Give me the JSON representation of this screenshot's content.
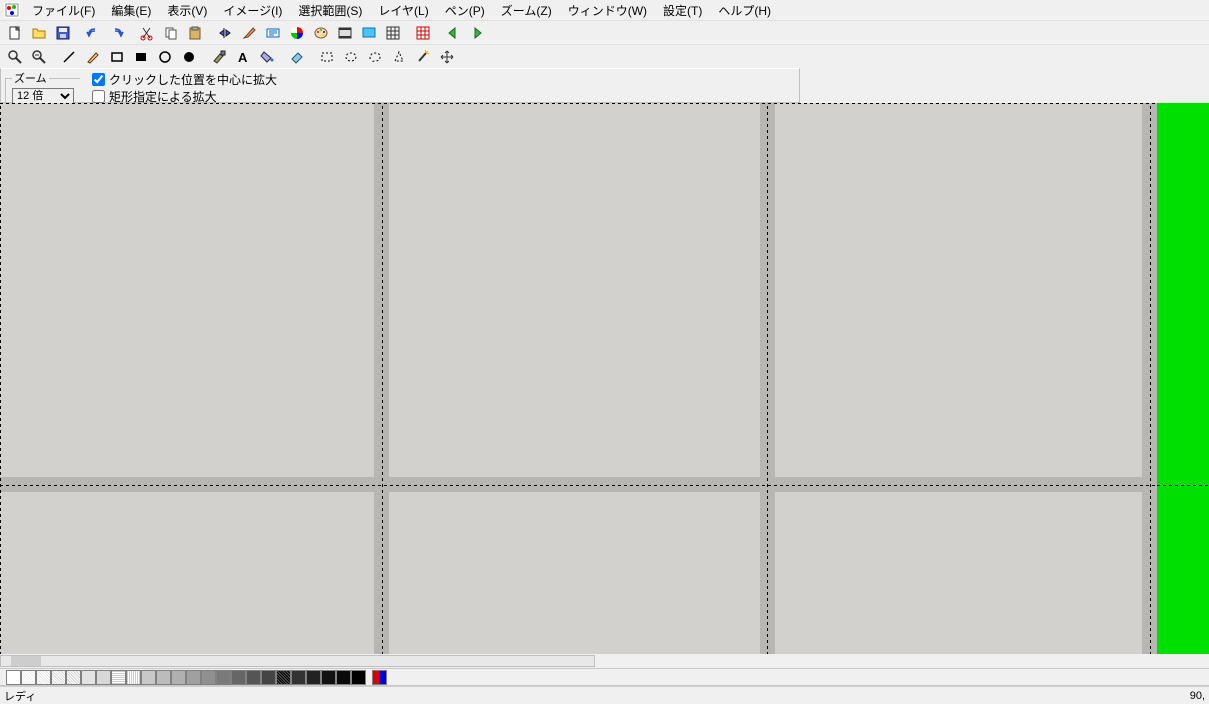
{
  "menu": {
    "file": "ファイル(F)",
    "edit": "編集(E)",
    "view": "表示(V)",
    "image": "イメージ(I)",
    "select": "選択範囲(S)",
    "layer": "レイヤ(L)",
    "pen": "ペン(P)",
    "zoom": "ズーム(Z)",
    "window": "ウィンドウ(W)",
    "settings": "設定(T)",
    "help": "ヘルプ(H)"
  },
  "options": {
    "zoom_legend": "ズーム",
    "zoom_value": "12 倍",
    "check_center": "クリックした位置を中心に拡大",
    "check_rect": "矩形指定による拡大"
  },
  "status": {
    "ready": "レディ",
    "coords": "90,"
  }
}
